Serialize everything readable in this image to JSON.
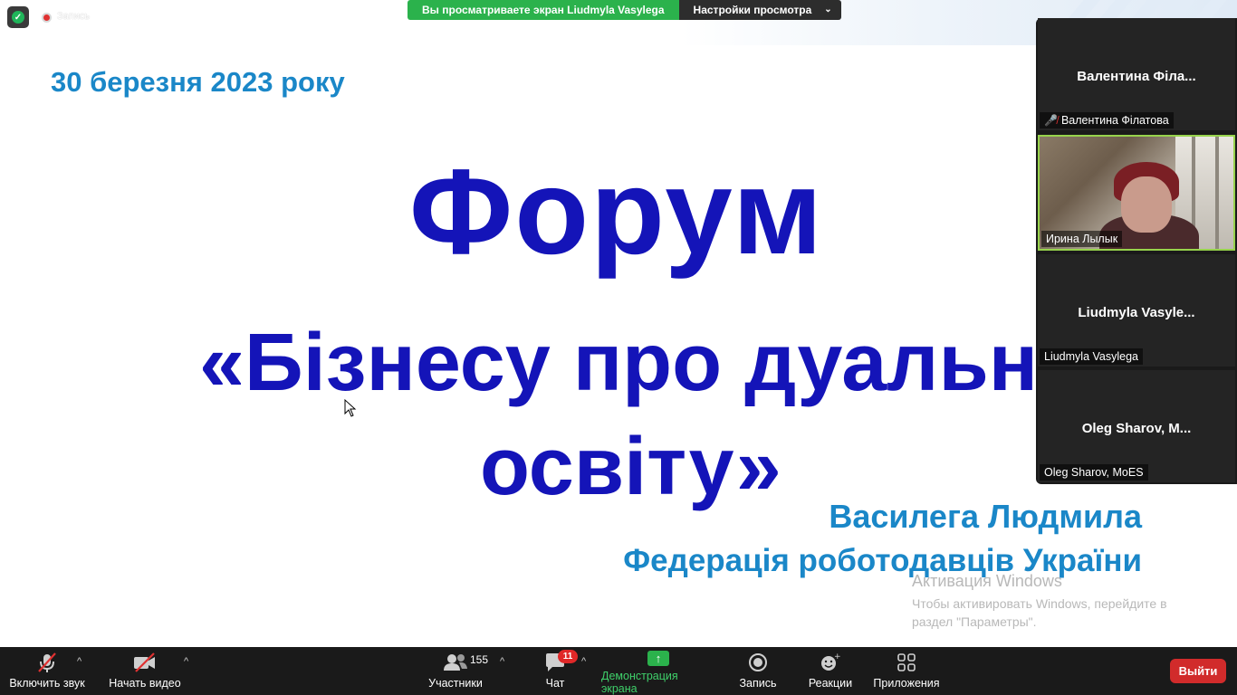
{
  "top_bar": {
    "recording_label": "Запись",
    "share_banner": "Вы просматриваете экран Liudmyla Vasylega",
    "view_options": "Настройки просмотра"
  },
  "slide": {
    "date": "30 березня 2023 року",
    "title": "Форум",
    "subtitle_line1": "«Бізнесу про дуальну",
    "subtitle_line2": "освіту»",
    "author": "Василега Людмила",
    "organization": "Федерація роботодавців України"
  },
  "participants": [
    {
      "display": "Валентина  Філа...",
      "label": "Валентина Філатова",
      "muted": true,
      "video": false
    },
    {
      "display": "",
      "label": "Ирина Лылык",
      "muted": false,
      "video": true
    },
    {
      "display": "Liudmyla  Vasyle...",
      "label": "Liudmyla Vasylega",
      "muted": false,
      "video": false
    },
    {
      "display": "Oleg  Sharov,  M...",
      "label": "Oleg Sharov, MoES",
      "muted": false,
      "video": false
    }
  ],
  "windows_activation": {
    "title": "Активация Windows",
    "text": "Чтобы активировать Windows, перейдите в раздел \"Параметры\"."
  },
  "toolbar": {
    "unmute": "Включить звук",
    "start_video": "Начать видео",
    "participants": "Участники",
    "participants_count": "155",
    "chat": "Чат",
    "chat_badge": "11",
    "share_screen": "Демонстрация экрана",
    "record": "Запись",
    "reactions": "Реакции",
    "apps": "Приложения",
    "leave": "Выйти"
  },
  "colors": {
    "slide_title": "#1414b8",
    "slide_accent": "#1a87c8",
    "share_green": "#2bb24c",
    "toolbar_bg": "#1a1a1a",
    "leave_red": "#d12b2b",
    "active_speaker": "#97d34c"
  }
}
